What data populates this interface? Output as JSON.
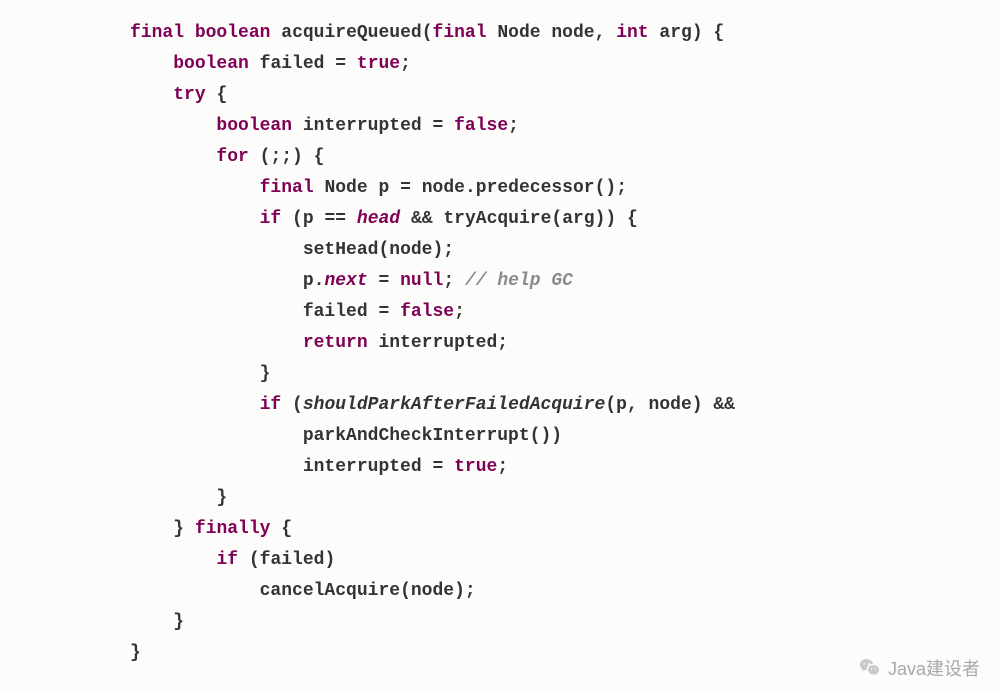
{
  "code": {
    "tokens": {
      "final": "final",
      "boolean": "boolean",
      "int": "int",
      "try": "try",
      "for": "for",
      "if": "if",
      "return": "return",
      "finally": "finally",
      "true": "true",
      "false": "false",
      "null": "null"
    },
    "identifiers": {
      "acquireQueued": "acquireQueued",
      "Node": "Node",
      "node": "node",
      "arg": "arg",
      "failed": "failed",
      "interrupted": "interrupted",
      "p": "p",
      "predecessor": "predecessor",
      "head": "head",
      "tryAcquire": "tryAcquire",
      "setHead": "setHead",
      "next": "next",
      "shouldParkAfterFailedAcquire": "shouldParkAfterFailedAcquire",
      "parkAndCheckInterrupt": "parkAndCheckInterrupt",
      "cancelAcquire": "cancelAcquire"
    },
    "comment_help_gc": "// help GC"
  },
  "watermark": "Java建设者"
}
